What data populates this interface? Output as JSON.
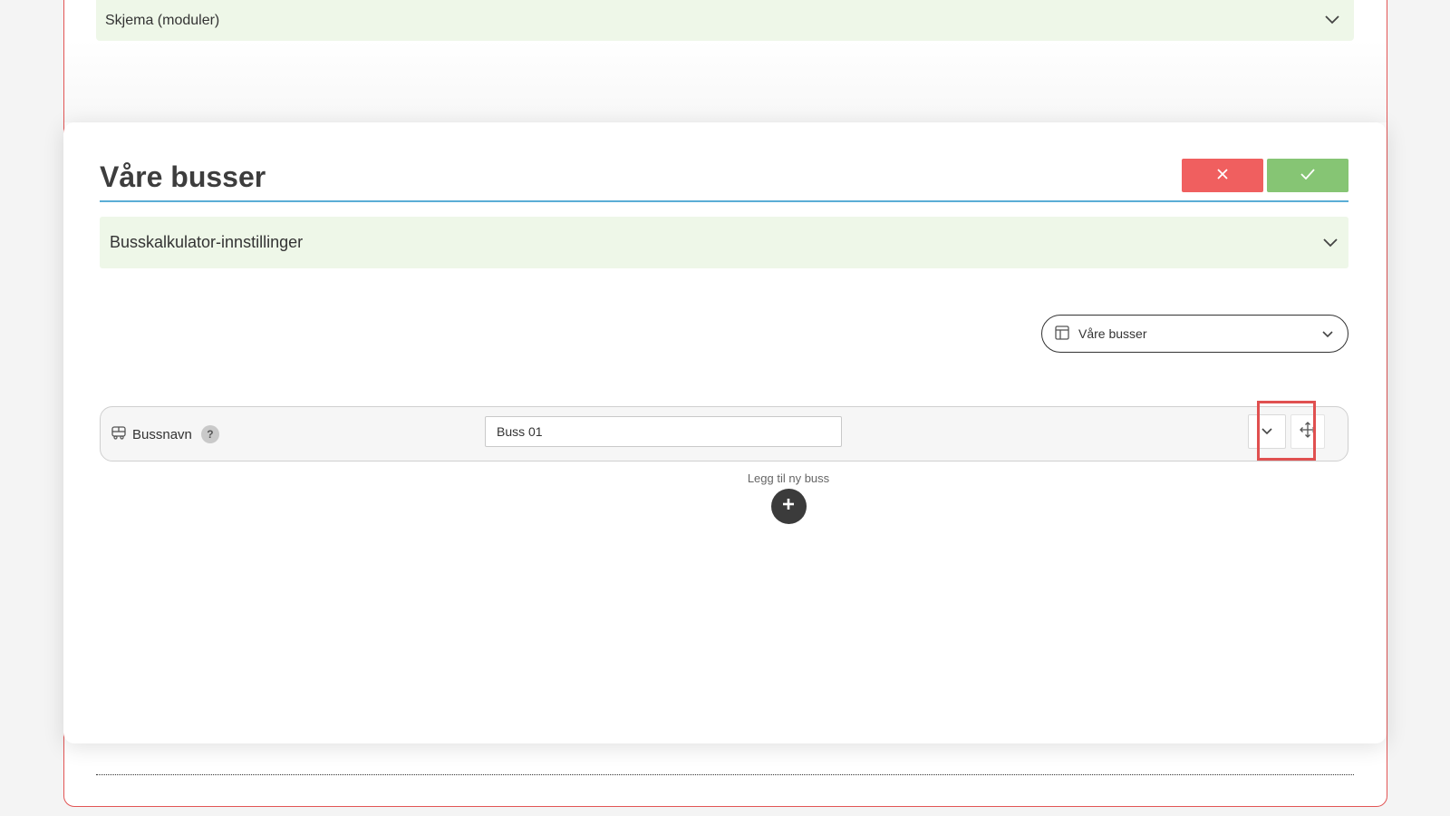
{
  "background": {
    "accordion_label": "Skjema (moduler)"
  },
  "modal": {
    "title": "Våre busser",
    "settings_label": "Busskalkulator-innstillinger",
    "select": {
      "value": "Våre busser"
    },
    "row": {
      "label": "Bussnavn",
      "help": "?",
      "input_value": "Buss 01"
    },
    "add_label": "Legg til ny buss"
  },
  "colors": {
    "cancel": "#f05f5f",
    "confirm": "#86c574",
    "accordion_bg": "#eef7e8",
    "title_underline": "#5aaed6",
    "highlight": "#e05050"
  },
  "icons": {
    "cancel": "close-icon",
    "confirm": "check-icon",
    "accordion": "chevron-down-icon",
    "select": "table-icon",
    "row": "bus-icon",
    "move": "move-icon",
    "add": "plus-icon"
  }
}
